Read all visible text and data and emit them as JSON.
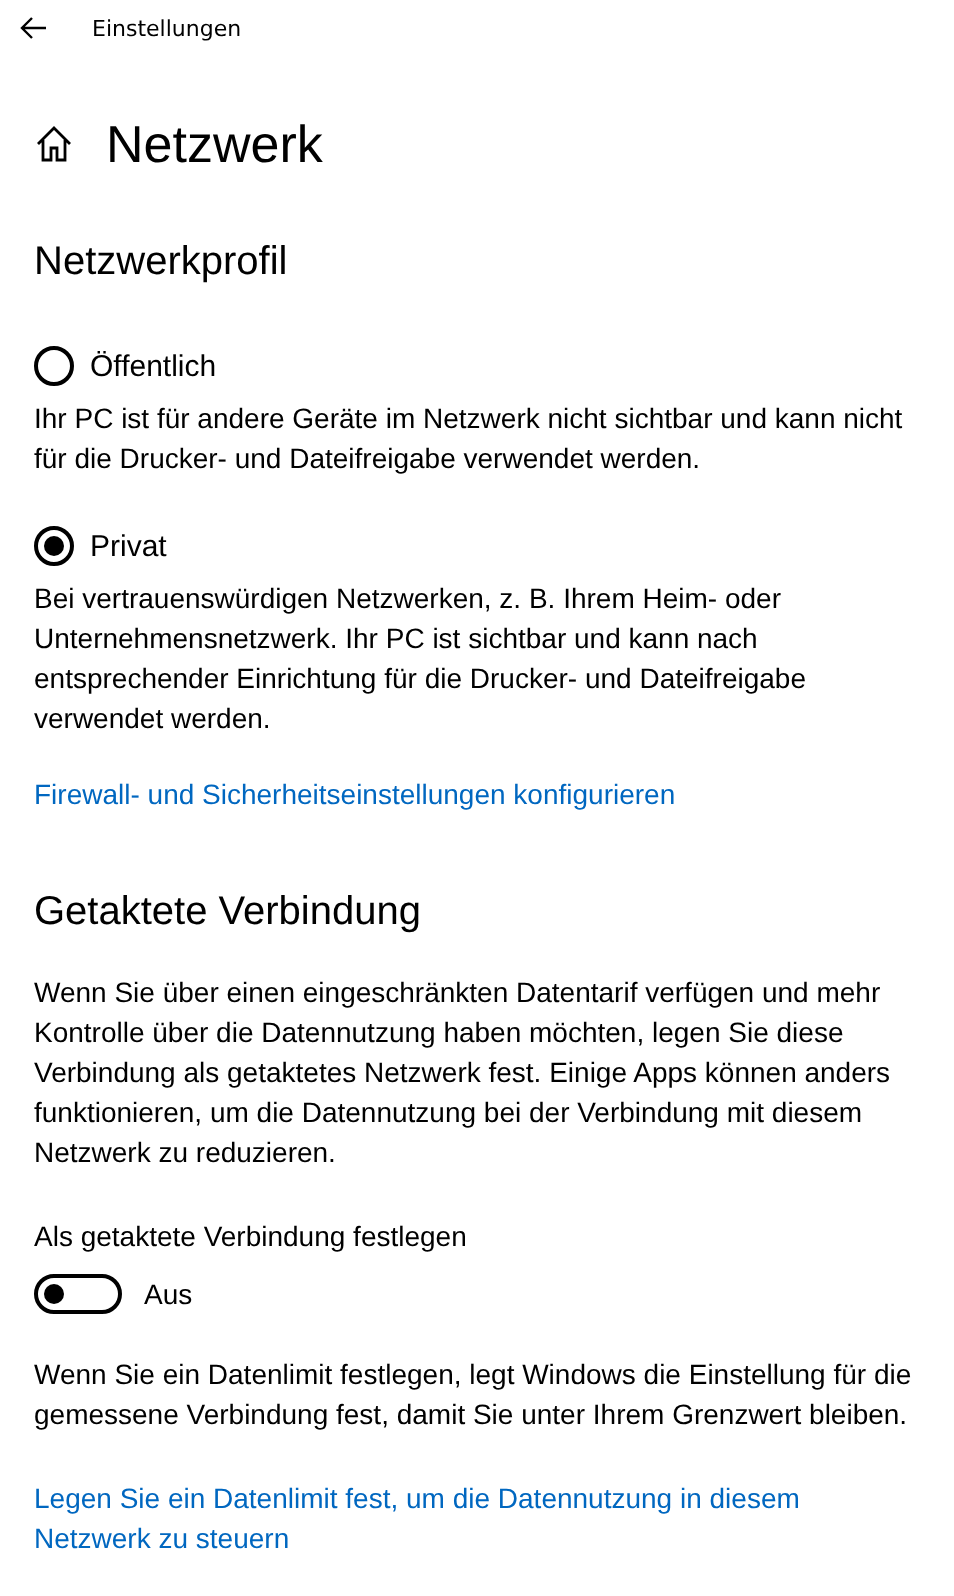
{
  "window": {
    "title": "Einstellungen"
  },
  "page": {
    "title": "Netzwerk"
  },
  "network_profile": {
    "heading": "Netzwerkprofil",
    "options": [
      {
        "label": "Öffentlich",
        "selected": false,
        "description": "Ihr PC ist für andere Geräte im Netzwerk nicht sichtbar und kann nicht für die Drucker- und Dateifreigabe verwendet werden."
      },
      {
        "label": "Privat",
        "selected": true,
        "description": "Bei vertrauenswürdigen Netzwerken, z. B. Ihrem Heim- oder Unternehmensnetzwerk. Ihr PC ist sichtbar und kann nach entsprechender Einrichtung für die Drucker- und Dateifreigabe verwendet werden."
      }
    ],
    "link": "Firewall- und Sicherheitseinstellungen konfigurieren"
  },
  "metered": {
    "heading": "Getaktete Verbindung",
    "description": "Wenn Sie über einen eingeschränkten Datentarif verfügen und mehr Kontrolle über die Datennutzung haben möchten, legen Sie diese Verbindung als getaktetes Netzwerk fest. Einige Apps können anders funktionieren, um die Datennutzung bei der Verbindung mit diesem Netzwerk zu reduzieren.",
    "toggle": {
      "label": "Als getaktete Verbindung festlegen",
      "on": false,
      "state_text": "Aus"
    },
    "note": "Wenn Sie ein Datenlimit festlegen, legt Windows die Einstellung für die gemessene Verbindung fest, damit Sie unter Ihrem Grenzwert bleiben.",
    "link": "Legen Sie ein Datenlimit fest, um die Datennutzung in diesem Netzwerk zu steuern"
  }
}
